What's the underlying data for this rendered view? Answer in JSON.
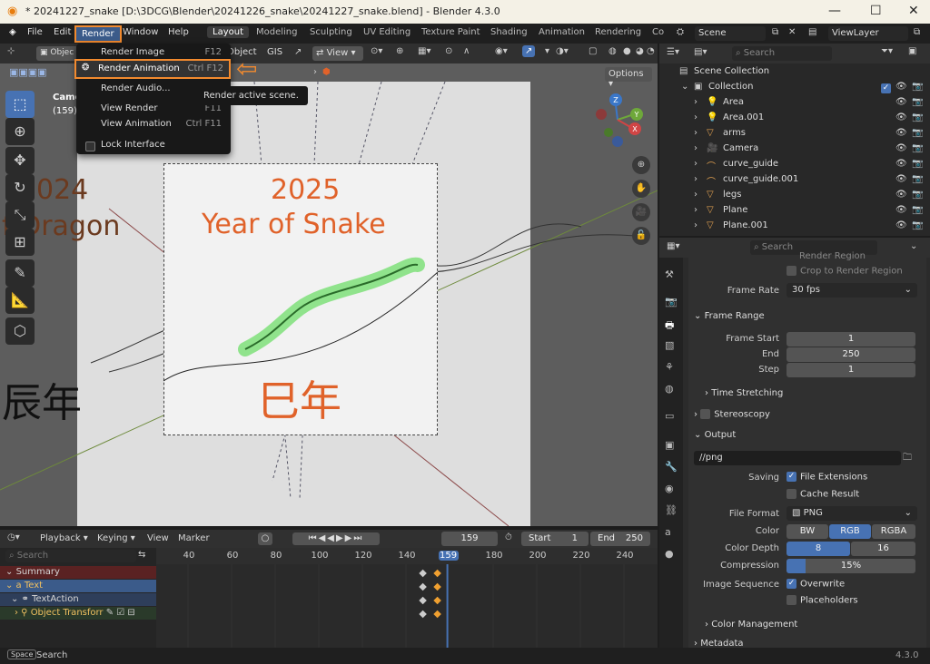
{
  "window": {
    "title": "* 20241227_snake [D:\\3DCG\\Blender\\20241226_snake\\20241227_snake.blend] - Blender 4.3.0"
  },
  "menu": {
    "file": "File",
    "edit": "Edit",
    "render": "Render",
    "window": "Window",
    "help": "Help"
  },
  "workspaces": [
    "Layout",
    "Modeling",
    "Sculpting",
    "UV Editing",
    "Texture Paint",
    "Shading",
    "Animation",
    "Rendering",
    "Co"
  ],
  "topright": {
    "scene": "Scene",
    "viewlayer": "ViewLayer"
  },
  "render_menu": {
    "items": [
      {
        "label": "Render Image",
        "shortcut": "F12"
      },
      {
        "label": "Render Animation",
        "shortcut": "Ctrl F12"
      },
      {
        "label": "Render Audio...",
        "shortcut": ""
      },
      {
        "label": "View Render",
        "shortcut": "F11"
      },
      {
        "label": "View Animation",
        "shortcut": "Ctrl F11"
      },
      {
        "label": "Lock Interface",
        "shortcut": ""
      }
    ],
    "tooltip": "Render active scene."
  },
  "viewport": {
    "mode_partial": "Objec",
    "object_label": "Object",
    "gis": "GIS",
    "view": "View",
    "options": "Options",
    "camera_label": "Came",
    "frame_label": "(159)",
    "year_number": "2025",
    "year_title": "Year of Snake",
    "kanji": "巳年",
    "bg_left_text1": "024",
    "bg_left_text2": "f Dragon",
    "bg_kanji": "辰年"
  },
  "outliner": {
    "search_placeholder": "Search",
    "root": "Scene Collection",
    "collection": "Collection",
    "items": [
      "Area",
      "Area.001",
      "arms",
      "Camera",
      "curve_guide",
      "curve_guide.001",
      "legs",
      "Plane",
      "Plane.001"
    ]
  },
  "properties": {
    "search_placeholder": "Search",
    "render_region": "Render Region",
    "crop_region": "Crop to Render Region",
    "frame_rate_label": "Frame Rate",
    "frame_rate": "30 fps",
    "frame_range": "Frame Range",
    "frame_start_label": "Frame Start",
    "frame_start": "1",
    "end_label": "End",
    "end": "250",
    "step_label": "Step",
    "step": "1",
    "time_stretching": "Time Stretching",
    "stereoscopy": "Stereoscopy",
    "output": "Output",
    "output_path": "//png",
    "saving_label": "Saving",
    "file_extensions": "File Extensions",
    "cache_result": "Cache Result",
    "file_format_label": "File Format",
    "file_format": "PNG",
    "color_label": "Color",
    "color_options": [
      "BW",
      "RGB",
      "RGBA"
    ],
    "color_depth_label": "Color Depth",
    "depth_options": [
      "8",
      "16"
    ],
    "compression_label": "Compression",
    "compression": "15%",
    "compression_fraction": 0.15,
    "image_sequence_label": "Image Sequence",
    "overwrite": "Overwrite",
    "placeholders": "Placeholders",
    "color_management": "Color Management",
    "metadata": "Metadata"
  },
  "timeline": {
    "playback": "Playback",
    "keying": "Keying",
    "view": "View",
    "marker": "Marker",
    "current_frame": "159",
    "start_label": "Start",
    "start": "1",
    "end_label": "End",
    "end": "250",
    "ruler": [
      "40",
      "60",
      "80",
      "100",
      "120",
      "140",
      "159",
      "180",
      "200",
      "220",
      "240"
    ],
    "search_placeholder": "Search",
    "channels": [
      "Summary",
      "Text",
      "TextAction",
      "Object Transforr"
    ]
  },
  "status": {
    "key": "Space",
    "action": "Search",
    "version": "4.3.0"
  },
  "colors": {
    "accent": "#4772b3",
    "orange": "#e0622a",
    "highlight": "#f28a2e"
  }
}
